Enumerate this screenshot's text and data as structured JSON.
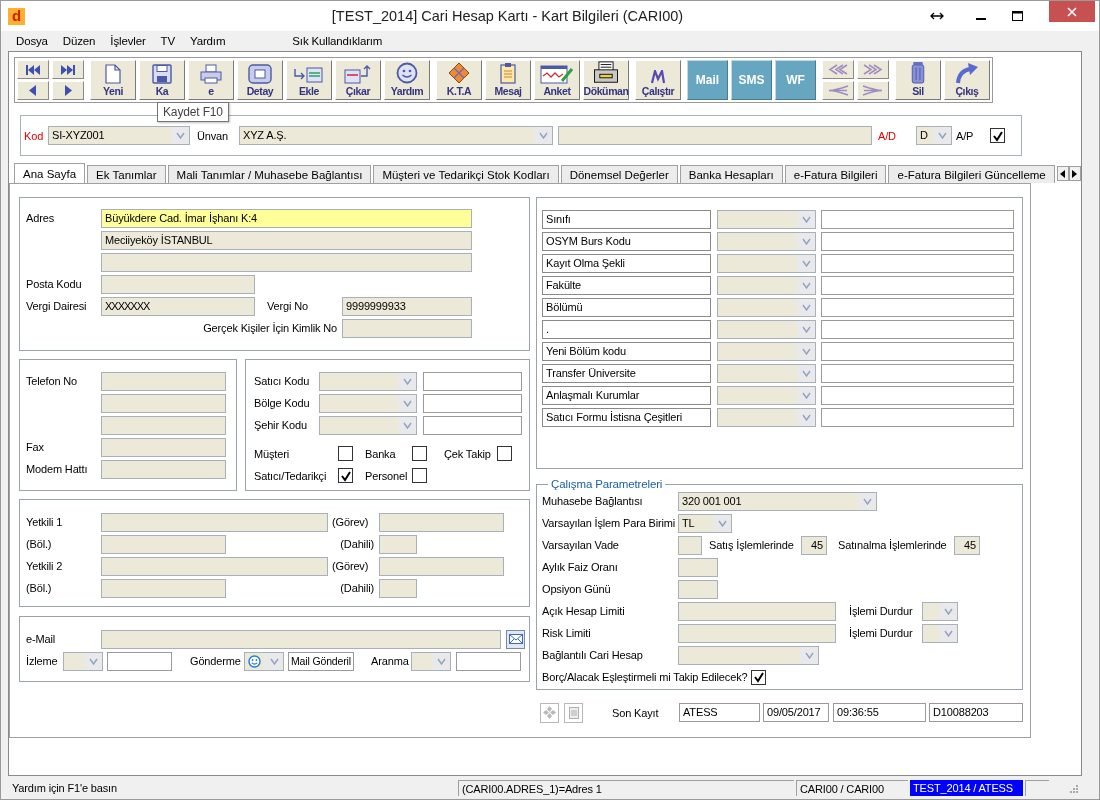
{
  "window": {
    "title": "[TEST_2014] Cari Hesap Kartı - Kart Bilgileri (CARI00)",
    "app_logo": "d"
  },
  "menu": [
    "Dosya",
    "Düzen",
    "İşlevler",
    "TV",
    "Yardım",
    "Sık Kullandıklarım"
  ],
  "toolbar": {
    "tooltip": "Kaydet F10",
    "groups": [
      {
        "kind": "nav"
      },
      {
        "kind": "tools",
        "items": [
          {
            "label": "Yeni"
          },
          {
            "label": "Ka"
          },
          {
            "label": "e"
          },
          {
            "label": "Detay"
          },
          {
            "label": "Ekle"
          },
          {
            "label": "Çıkar"
          },
          {
            "label": "Yardım"
          }
        ]
      },
      {
        "kind": "tools",
        "items": [
          {
            "label": "K.T.A"
          },
          {
            "label": "Mesaj"
          },
          {
            "label": "Anket"
          },
          {
            "label": "Döküman"
          }
        ]
      },
      {
        "kind": "tools",
        "items": [
          {
            "label": "Çalıştır"
          }
        ]
      },
      {
        "kind": "colored",
        "items": [
          {
            "label": "Mail"
          },
          {
            "label": "SMS"
          },
          {
            "label": "WF"
          }
        ]
      },
      {
        "kind": "nav"
      },
      {
        "kind": "tools",
        "items": [
          {
            "label": "Sil"
          },
          {
            "label": "Çıkış"
          }
        ]
      }
    ]
  },
  "header": {
    "kod": {
      "label": "Kod",
      "value": "SI-XYZ001"
    },
    "unvan": {
      "label": "Ünvan",
      "value": "XYZ A.Ş."
    },
    "ad": {
      "label": "A/D",
      "value": "D"
    },
    "ap": {
      "label": "A/P",
      "checked": true
    }
  },
  "tabs": [
    {
      "label": "Ana Sayfa",
      "selected": true
    },
    {
      "label": "Ek Tanımlar",
      "selected": false
    },
    {
      "label": "Mali Tanımlar / Muhasebe Bağlantısı",
      "selected": false
    },
    {
      "label": "Müşteri ve Tedarikçi Stok Kodları",
      "selected": false
    },
    {
      "label": "Dönemsel Değerler",
      "selected": false
    },
    {
      "label": "Banka Hesapları",
      "selected": false
    },
    {
      "label": "e-Fatura Bilgileri",
      "selected": false
    },
    {
      "label": "e-Fatura Bilgileri Güncelleme",
      "selected": false
    }
  ],
  "address": {
    "label": "Adres",
    "lines": [
      {
        "value": "Büyükdere Cad. İmar İşhanı K:4",
        "focused": true
      },
      {
        "value": "Meciiyeköy İSTANBUL",
        "focused": false
      },
      {
        "focused": false
      }
    ],
    "postal_code": {
      "label": "Posta Kodu"
    },
    "tax_office": {
      "label": "Vergi Dairesi",
      "value": "XXXXXXX"
    },
    "tax_no": {
      "label": "Vergi No",
      "value": "9999999933"
    },
    "id_no": {
      "label": "Gerçek Kişiler İçin Kimlik No"
    }
  },
  "contact": {
    "phone": "Telefon No",
    "fax": "Fax",
    "modem": "Modem Hattı"
  },
  "codes": [
    {
      "label": "Satıcı Kodu"
    },
    {
      "label": "Bölge Kodu"
    },
    {
      "label": "Şehir Kodu"
    }
  ],
  "flags": [
    {
      "label": "Müşteri",
      "checked": false
    },
    {
      "label": "Banka",
      "checked": false
    },
    {
      "label": "Çek Takip",
      "checked": false
    },
    {
      "label": "Satıcı/Tedarikçi",
      "checked": true
    },
    {
      "label": "Personel",
      "checked": false
    }
  ],
  "contacts": [
    {
      "label": "Yetkili 1",
      "department": "(Böl.)",
      "role": "(Görev)",
      "extension": "(Dahili)"
    },
    {
      "label": "Yetkili 2",
      "department": "(Böl.)",
      "role": "(Görev)",
      "extension": "(Dahili)"
    }
  ],
  "email": {
    "label": "e-Mail",
    "tracking": "İzleme",
    "sending": "Gönderme",
    "sending_value": "Mail Gönderil",
    "calling": "Aranma"
  },
  "extra_fields": [
    {
      "label": "Sınıfı"
    },
    {
      "label": "OSYM Burs Kodu"
    },
    {
      "label": "Kayıt Olma Şekli"
    },
    {
      "label": "Fakülte"
    },
    {
      "label": "Bölümü"
    },
    {
      "label": "."
    },
    {
      "label": "Yeni Bölüm kodu"
    },
    {
      "label": "Transfer Üniversite"
    },
    {
      "label": "Anlaşmalı Kurumlar"
    },
    {
      "label": "Satıcı Formu İstisna Çeşitleri"
    }
  ],
  "params": {
    "title": "Çalışma Parametreleri",
    "accounting": {
      "label": "Muhasebe Bağlantısı",
      "value": "320 001 001"
    },
    "currency": {
      "label": "Varsayılan İşlem Para Birimi",
      "value": "TL"
    },
    "term": {
      "label": "Varsayılan Vade",
      "sales_label": "Satış İşlemlerinde",
      "sales_value": "45",
      "purchase_label": "Satınalma İşlemlerinde",
      "purchase_value": "45"
    },
    "interest": {
      "label": "Aylık Faiz Oranı"
    },
    "option": {
      "label": "Opsiyon Günü"
    },
    "open_limit": {
      "label": "Açık Hesap Limiti",
      "stop_label": "İşlemi Durdur"
    },
    "risk_limit": {
      "label": "Risk Limiti",
      "stop_label": "İşlemi Durdur"
    },
    "linked": {
      "label": "Bağlantılı Cari Hesap"
    },
    "matching": {
      "label": "Borç/Alacak Eşleştirmeli mi Takip Edilecek?",
      "checked": true
    }
  },
  "last_record": {
    "label": "Son Kayıt",
    "values": [
      "ATESS",
      "09/05/2017",
      "09:36:55",
      "D10088203"
    ]
  },
  "status_bar": {
    "hint": "Yardım için F1'e basın",
    "field": "(CARI00.ADRES_1)=Adres 1",
    "table": "CARI00 / CARI00",
    "session": "TEST_2014 / ATESS"
  }
}
